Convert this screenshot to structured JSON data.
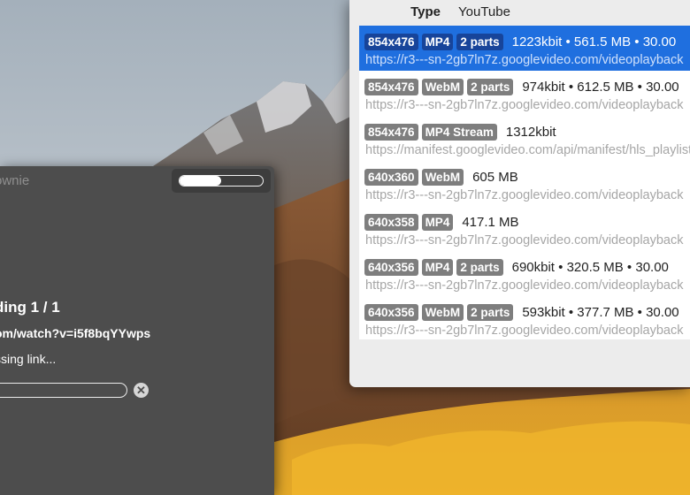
{
  "download_window": {
    "title": "ownie",
    "status": "ding 1 / 1",
    "url": "om/watch?v=i5f8bqYYwps",
    "substatus": "ssing link...",
    "mini_progress": 0.5,
    "progress": 0,
    "cancel_icon": "close-circle-icon"
  },
  "formats_panel": {
    "type_label": "Type",
    "type_value": "YouTube",
    "items": [
      {
        "tags": [
          "854x476",
          "MP4",
          "2 parts"
        ],
        "info": "1223kbit • 561.5 MB • 30.00",
        "url": "https://r3---sn-2gb7ln7z.googlevideo.com/videoplayback",
        "selected": true
      },
      {
        "tags": [
          "854x476",
          "WebM",
          "2 parts"
        ],
        "info": "974kbit • 612.5 MB • 30.00",
        "url": "https://r3---sn-2gb7ln7z.googlevideo.com/videoplayback",
        "selected": false
      },
      {
        "tags": [
          "854x476",
          "MP4 Stream"
        ],
        "info": "1312kbit",
        "url": "https://manifest.googlevideo.com/api/manifest/hls_playlist",
        "selected": false
      },
      {
        "tags": [
          "640x360",
          "WebM"
        ],
        "info": "605 MB",
        "url": "https://r3---sn-2gb7ln7z.googlevideo.com/videoplayback",
        "selected": false
      },
      {
        "tags": [
          "640x358",
          "MP4"
        ],
        "info": "417.1 MB",
        "url": "https://r3---sn-2gb7ln7z.googlevideo.com/videoplayback",
        "selected": false
      },
      {
        "tags": [
          "640x356",
          "MP4",
          "2 parts"
        ],
        "info": "690kbit • 320.5 MB • 30.00",
        "url": "https://r3---sn-2gb7ln7z.googlevideo.com/videoplayback",
        "selected": false
      },
      {
        "tags": [
          "640x356",
          "WebM",
          "2 parts"
        ],
        "info": "593kbit • 377.7 MB • 30.00",
        "url": "https://r3---sn-2gb7ln7z.googlevideo.com/videoplayback",
        "selected": false
      }
    ]
  },
  "colors": {
    "selection": "#1f6fdf",
    "tag": "#7e7e7e",
    "window": "#4d4d4d"
  }
}
